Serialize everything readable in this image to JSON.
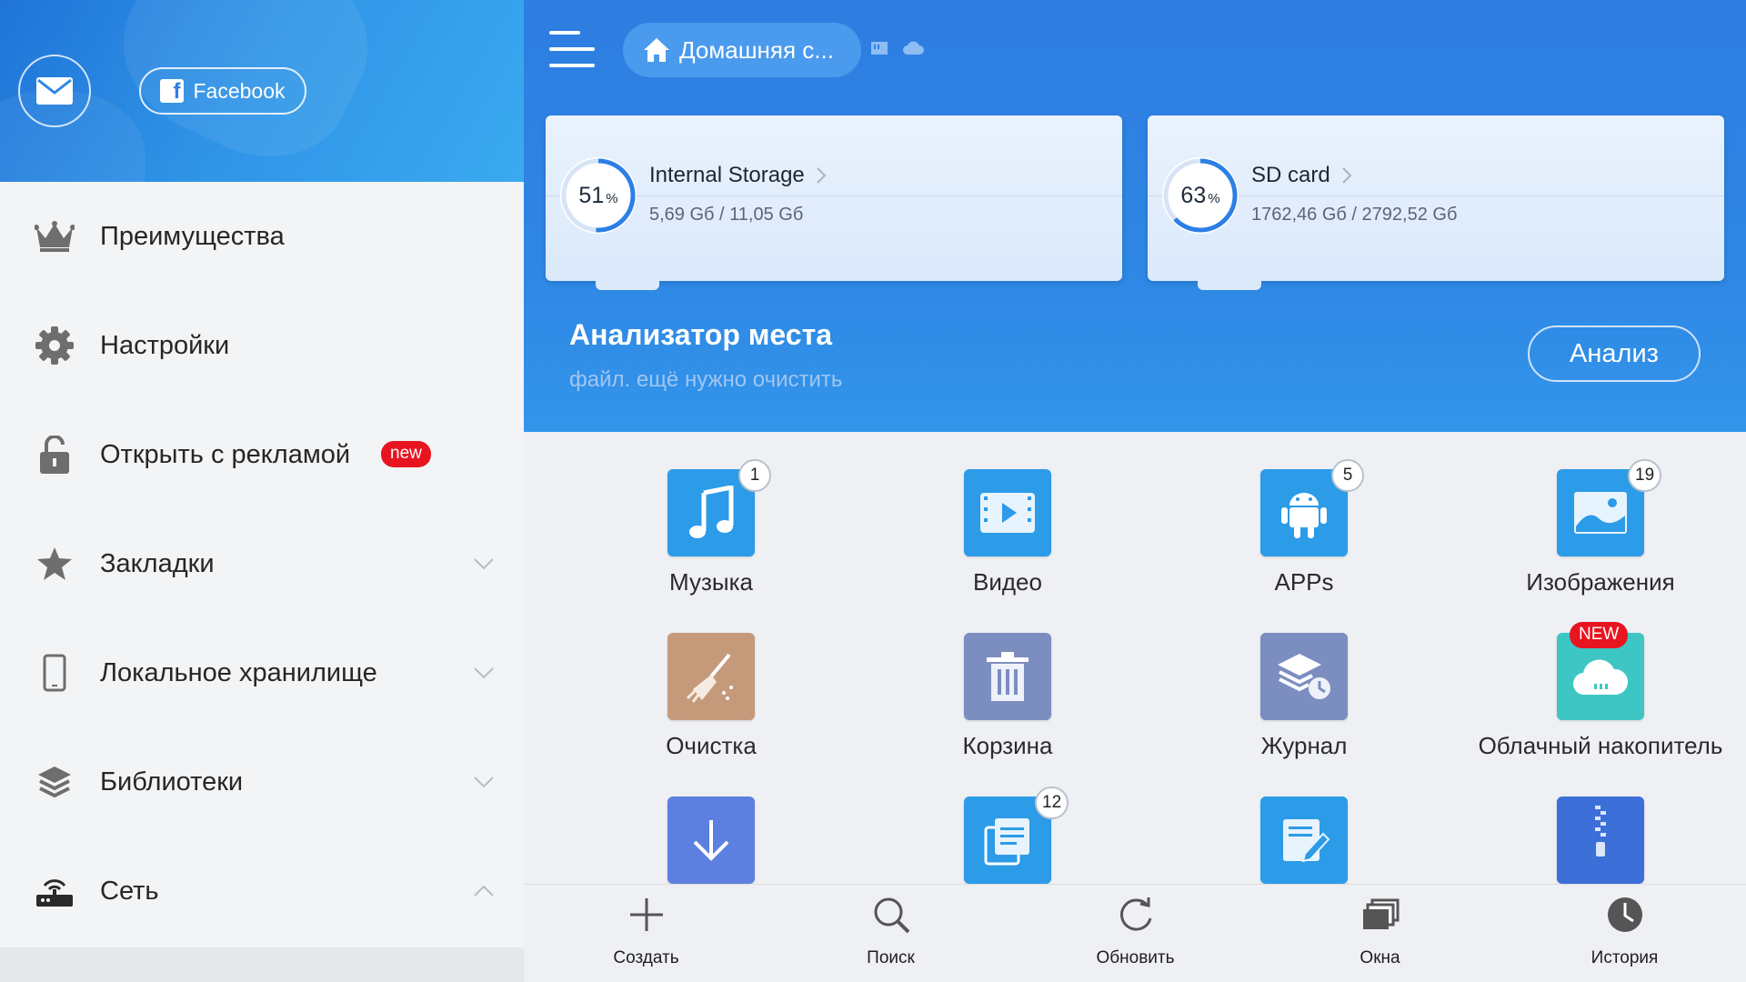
{
  "sidebar": {
    "facebook_label": "Facebook",
    "items": [
      {
        "label": "Преимущества",
        "icon": "crown-icon"
      },
      {
        "label": "Настройки",
        "icon": "gear-icon"
      },
      {
        "label": "Открыть с рекламой",
        "icon": "unlock-icon",
        "badge": "new"
      },
      {
        "label": "Закладки",
        "icon": "star-icon",
        "chevron": "down"
      },
      {
        "label": "Локальное хранилище",
        "icon": "phone-icon",
        "chevron": "down"
      },
      {
        "label": "Библиотеки",
        "icon": "layers-icon",
        "chevron": "down"
      },
      {
        "label": "Сеть",
        "icon": "router-icon",
        "chevron": "up"
      }
    ]
  },
  "header": {
    "home_label": "Домашняя с..."
  },
  "storage": [
    {
      "name": "Internal Storage",
      "percent": 51,
      "percent_sign": "%",
      "usage": "5,69 Gб / 11,05 Gб"
    },
    {
      "name": "SD card",
      "percent": 63,
      "percent_sign": "%",
      "usage": "1762,46 Gб / 2792,52 Gб"
    }
  ],
  "analyzer": {
    "title": "Анализатор места",
    "subtitle": "файл. ещё нужно очистить",
    "button": "Анализ"
  },
  "categories": [
    {
      "label": "Музыка",
      "count": "1",
      "color": "#2c9be8"
    },
    {
      "label": "Видео",
      "count": "",
      "color": "#2c9be8"
    },
    {
      "label": "APPs",
      "count": "5",
      "color": "#2c9be8"
    },
    {
      "label": "Изображения",
      "count": "19",
      "color": "#2c9be8"
    },
    {
      "label": "Очистка",
      "count": "",
      "color": "#c59a7b"
    },
    {
      "label": "Корзина",
      "count": "",
      "color": "#7c8ec0"
    },
    {
      "label": "Журнал",
      "count": "",
      "color": "#7c8ec0"
    },
    {
      "label": "Облачный накопитель",
      "count": "",
      "badge": "NEW",
      "color": "#3dc6c3"
    },
    {
      "label": "",
      "count": "",
      "color": "#5d7fe0"
    },
    {
      "label": "",
      "count": "12",
      "color": "#2c9be8"
    },
    {
      "label": "",
      "count": "",
      "color": "#2c9be8"
    },
    {
      "label": "",
      "count": "",
      "color": "#3d6fd8"
    }
  ],
  "bottom_bar": [
    {
      "label": "Создать",
      "icon": "plus-icon"
    },
    {
      "label": "Поиск",
      "icon": "search-icon"
    },
    {
      "label": "Обновить",
      "icon": "refresh-icon"
    },
    {
      "label": "Окна",
      "icon": "windows-icon"
    },
    {
      "label": "История",
      "icon": "clock-icon"
    }
  ]
}
